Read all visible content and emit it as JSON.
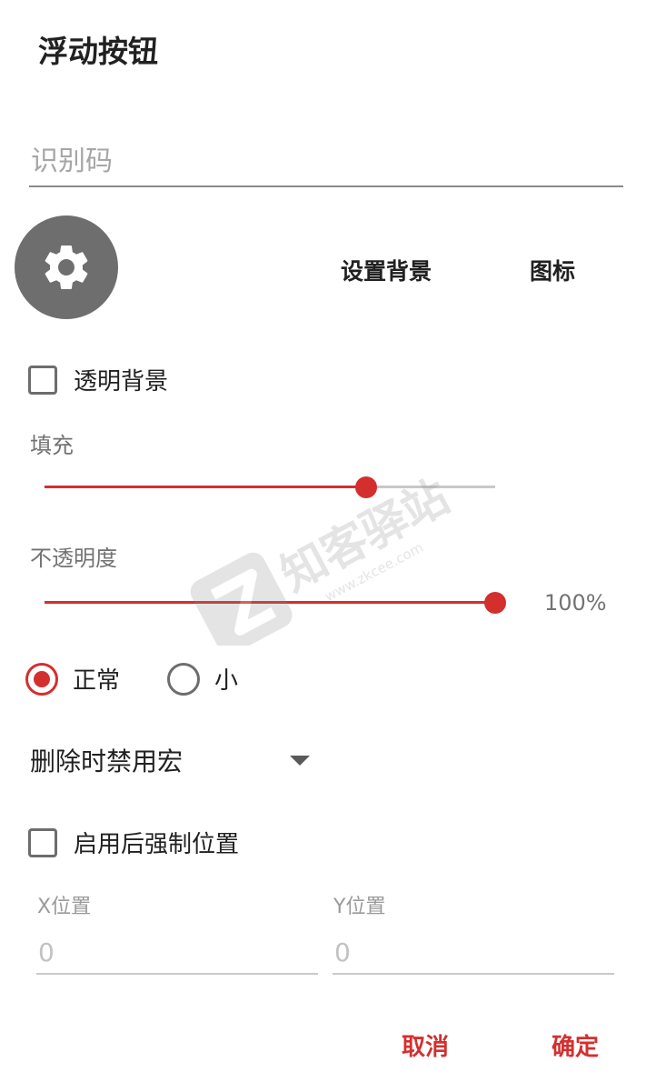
{
  "dialog": {
    "title": "浮动按钮"
  },
  "id_field": {
    "placeholder": "识别码",
    "value": ""
  },
  "icon_row": {
    "fab_icon": "gear-icon",
    "set_background_label": "设置背景",
    "icon_label": "图标"
  },
  "transparent_bg": {
    "label": "透明背景",
    "checked": false
  },
  "fill": {
    "label": "填充",
    "value_fraction": 0.71
  },
  "opacity": {
    "label": "不透明度",
    "value_text": "100%",
    "value_fraction": 1.0
  },
  "size_options": [
    {
      "label": "正常",
      "selected": true
    },
    {
      "label": "小",
      "selected": false
    }
  ],
  "disable_macro": {
    "selected": "删除时禁用宏"
  },
  "force_position": {
    "label": "启用后强制位置",
    "checked": false
  },
  "position": {
    "x_label": "X位置",
    "x_placeholder": "0",
    "y_label": "Y位置",
    "y_placeholder": "0"
  },
  "actions": {
    "cancel": "取消",
    "ok": "确定"
  },
  "watermark": {
    "brand": "知客驿站",
    "url": "www.zkcee.com"
  },
  "colors": {
    "accent": "#d32f2f",
    "fab_bg": "#6e6e6e",
    "text": "#212121",
    "secondary_text": "#737373"
  }
}
